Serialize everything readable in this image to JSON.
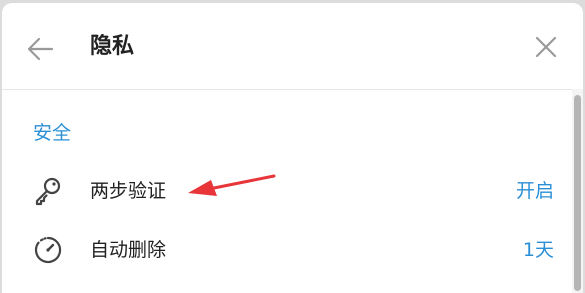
{
  "header": {
    "title": "隐私",
    "back_icon": "arrow-left-icon",
    "close_icon": "close-icon"
  },
  "section": {
    "title": "安全"
  },
  "rows": [
    {
      "icon": "key-icon",
      "label": "两步验证",
      "value": "开启"
    },
    {
      "icon": "timer-icon",
      "label": "自动删除",
      "value": "1天"
    }
  ],
  "colors": {
    "accent": "#2b8fd6",
    "annotation": "#e8353a",
    "text": "#222222",
    "icon": "#9a9a9a"
  }
}
